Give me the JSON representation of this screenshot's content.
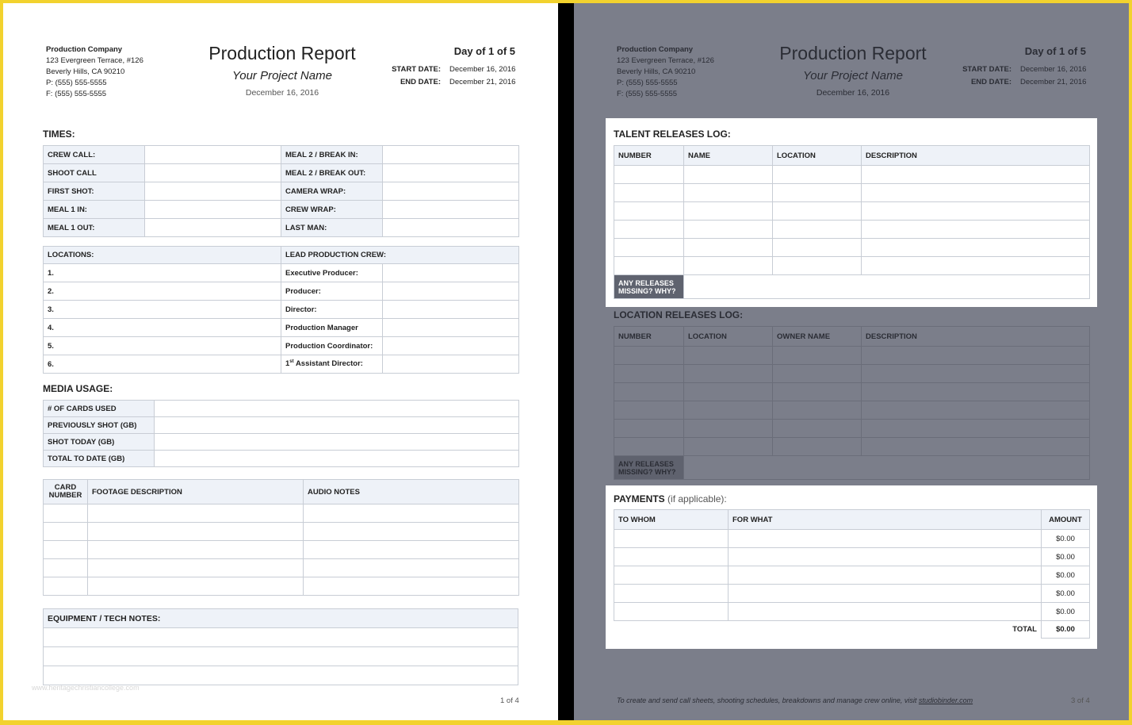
{
  "page1": {
    "company": {
      "name": "Production Company",
      "address1": "123 Evergreen Terrace, #126",
      "address2": "Beverly Hills, CA 90210",
      "phone": "P: (555) 555-5555",
      "fax": "F: (555) 555-5555"
    },
    "title": "Production Report",
    "project": "Your Project Name",
    "date": "December 16, 2016",
    "day_of": "Day of 1 of 5",
    "start_label": "START DATE:",
    "start_value": "December 16, 2016",
    "end_label": "END DATE:",
    "end_value": "December 21, 2016",
    "times_heading": "TIMES:",
    "times": [
      {
        "left": "CREW CALL:",
        "right": "MEAL 2 / BREAK IN:"
      },
      {
        "left": "SHOOT CALL",
        "right": "MEAL 2 / BREAK OUT:"
      },
      {
        "left": "FIRST SHOT:",
        "right": "CAMERA WRAP:"
      },
      {
        "left": "MEAL 1 IN:",
        "right": "CREW WRAP:"
      },
      {
        "left": "MEAL 1 OUT:",
        "right": "LAST MAN:"
      }
    ],
    "locations_heading": "LOCATIONS:",
    "crew_heading": "LEAD PRODUCTION CREW:",
    "locations": [
      "1.",
      "2.",
      "3.",
      "4.",
      "5.",
      "6."
    ],
    "crew": [
      "Executive Producer:",
      "Producer:",
      "Director:",
      "Production Manager",
      "Production Coordinator:",
      "Assistant Director:"
    ],
    "crew_ordinal_num": "1",
    "crew_ordinal_sup": "st",
    "media_heading": "MEDIA USAGE:",
    "media": [
      "# OF CARDS USED",
      "PREVIOUSLY SHOT (GB)",
      "SHOT TODAY (GB)",
      "TOTAL TO DATE (GB)"
    ],
    "footage_headers": {
      "card": "CARD NUMBER",
      "footage": "FOOTAGE DESCRIPTION",
      "audio": "AUDIO NOTES"
    },
    "equipment_heading": "EQUIPMENT / TECH NOTES:",
    "watermark": "www.heritagechristiancollege.com",
    "page_num": "1 of 4"
  },
  "page2": {
    "company": {
      "name": "Production Company",
      "address1": "123 Evergreen Terrace, #126",
      "address2": "Beverly Hills, CA 90210",
      "phone": "P: (555) 555-5555",
      "fax": "F: (555) 555-5555"
    },
    "title": "Production Report",
    "project": "Your Project Name",
    "date": "December 16, 2016",
    "day_of": "Day of 1 of 5",
    "start_label": "START DATE:",
    "start_value": "December 16, 2016",
    "end_label": "END DATE:",
    "end_value": "December 21, 2016",
    "talent_heading": "TALENT RELEASES LOG:",
    "talent_headers": [
      "NUMBER",
      "NAME",
      "LOCATION",
      "DESCRIPTION"
    ],
    "missing_label": "ANY RELEASES MISSING? WHY?",
    "location_heading": "LOCATION RELEASES LOG:",
    "location_headers": [
      "NUMBER",
      "LOCATION",
      "OWNER NAME",
      "DESCRIPTION"
    ],
    "payments_heading": "PAYMENTS",
    "payments_sub": "(if applicable):",
    "payments_headers": {
      "whom": "TO WHOM",
      "what": "FOR WHAT",
      "amount": "AMOUNT"
    },
    "payments_amounts": [
      "$0.00",
      "$0.00",
      "$0.00",
      "$0.00",
      "$0.00"
    ],
    "total_label": "TOTAL",
    "total_value": "$0.00",
    "footer_text": "To create and send call sheets, shooting schedules, breakdowns and manage crew online, visit ",
    "footer_link": "studiobinder.com",
    "page_num": "3 of 4"
  },
  "colors": {
    "background": "#f2d22e",
    "divider": "#000000",
    "page2_overlay": "#7b7e8a",
    "label_fill": "#eef2f8",
    "missing_fill": "#5f636f"
  }
}
